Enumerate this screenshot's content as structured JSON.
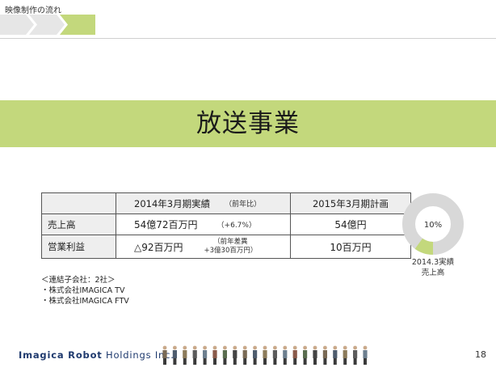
{
  "header": {
    "section_label": "映像制作の流れ"
  },
  "banner": {
    "title": "放送事業"
  },
  "table": {
    "header": {
      "col1": "2014年3月期実績",
      "col1_note": "（前年比）",
      "col2": "2015年3月期計画"
    },
    "rows": [
      {
        "label": "売上高",
        "actual": "54億72百万円",
        "note": "（+6.7%）",
        "plan": "54億円"
      },
      {
        "label": "営業利益",
        "actual": "△92百万円",
        "note_line1": "（前年差異",
        "note_line2": "+3億30百万円）",
        "plan": "10百万円"
      }
    ]
  },
  "donut": {
    "percent_label": "10%",
    "share": 0.1,
    "caption_line1": "2014.3実績",
    "caption_line2": "売上高",
    "colors": {
      "highlight": "#c3d87c",
      "rest": "#d8d8d8"
    }
  },
  "notes": {
    "line1": "＜連結子会社：2社＞",
    "line2": "・株式会社IMAGICA TV",
    "line3": "・株式会社IMAGICA FTV"
  },
  "footer": {
    "logo_bold": "Imagica Robot",
    "logo_light": " Holdings Inc.",
    "page_number": "18"
  },
  "colors": {
    "accent": "#c3d87c",
    "logo": "#1f3a6e"
  }
}
